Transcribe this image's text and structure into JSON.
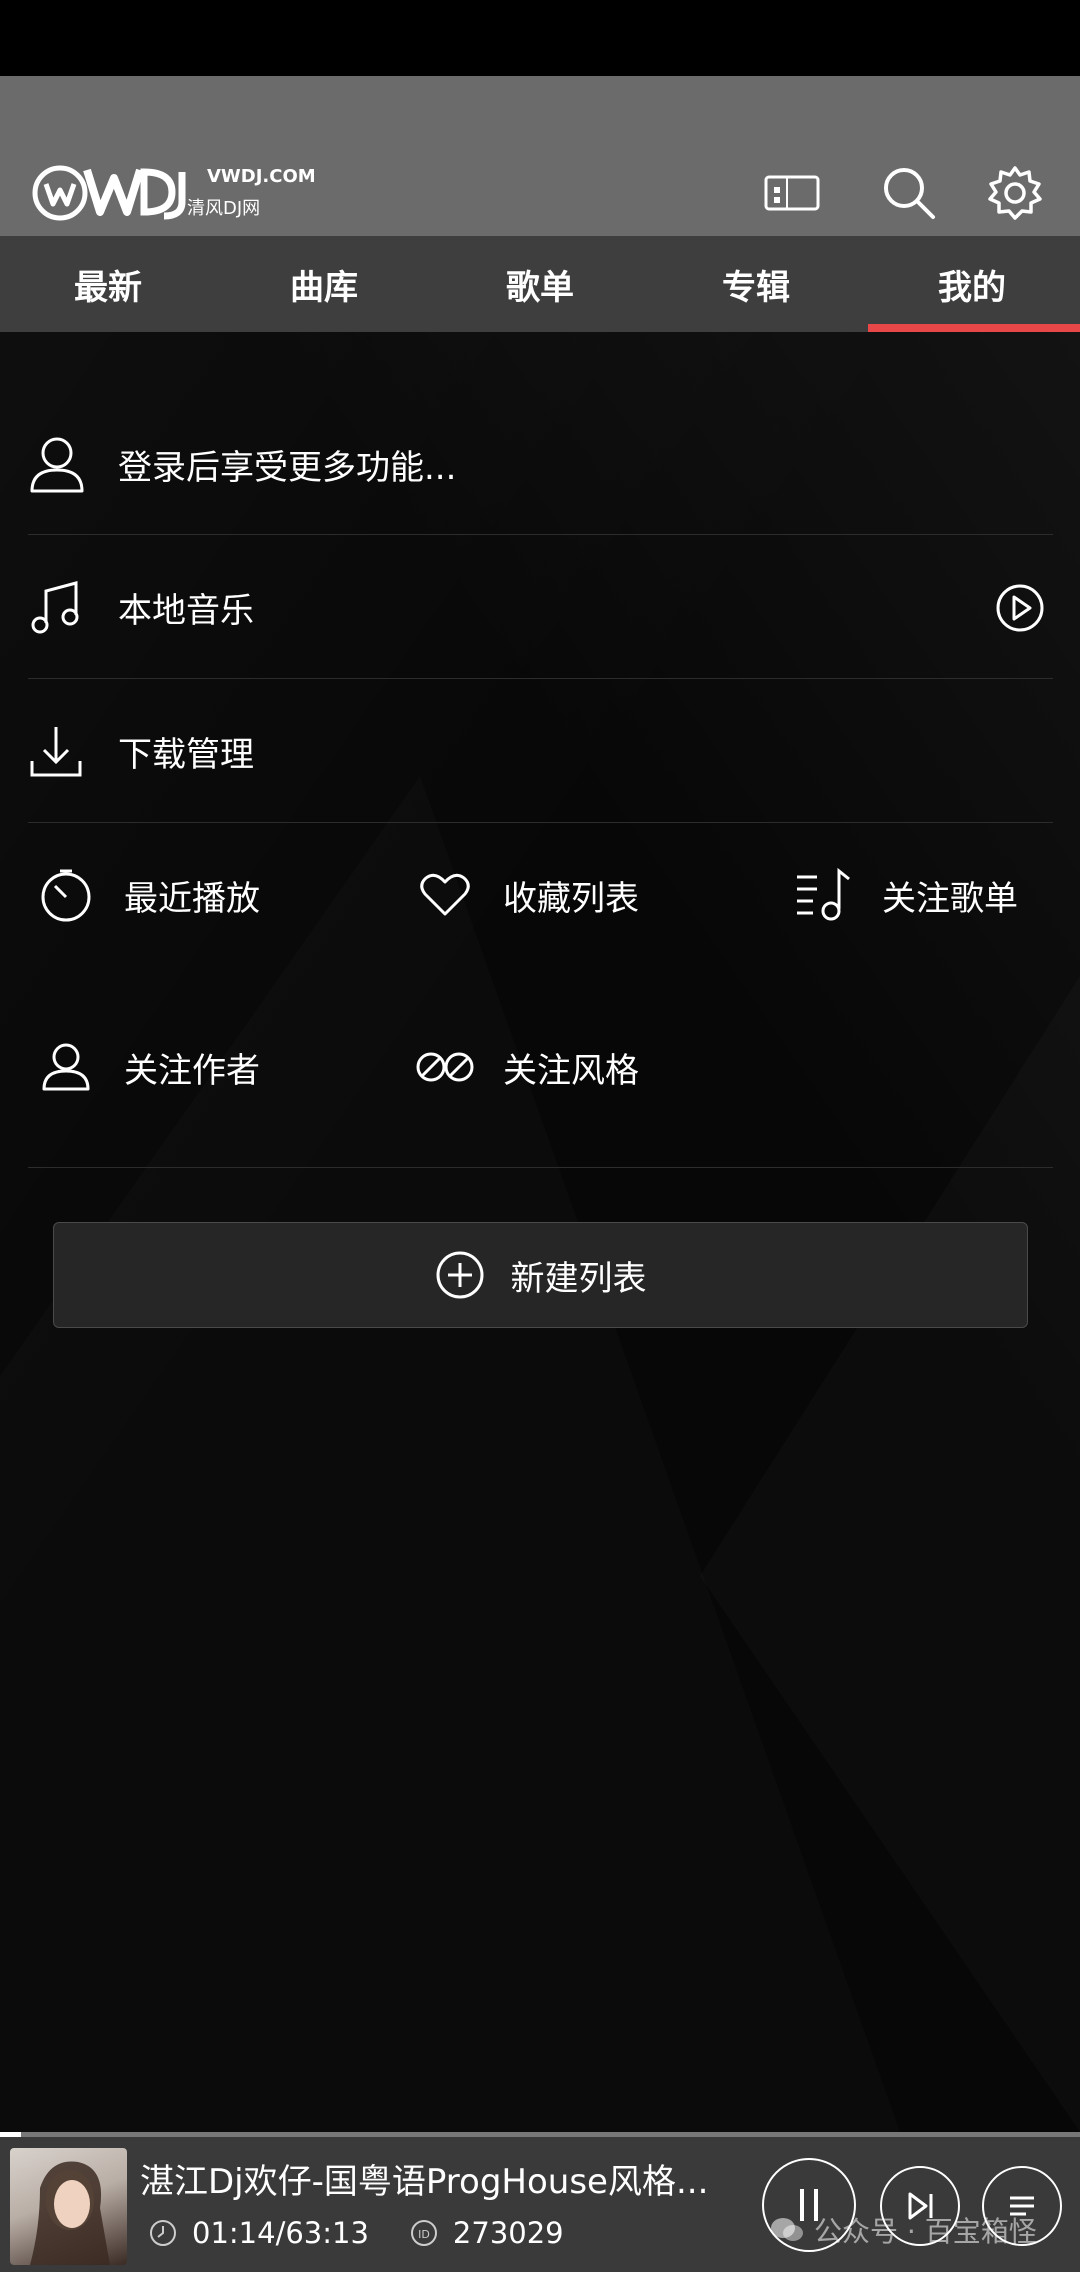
{
  "header": {
    "logo_text": "VWDJ.COM",
    "logo_sub": "清风DJ网"
  },
  "tabs": [
    {
      "label": "最新"
    },
    {
      "label": "曲库"
    },
    {
      "label": "歌单"
    },
    {
      "label": "专辑"
    },
    {
      "label": "我的",
      "active": true
    }
  ],
  "mine": {
    "login_prompt": "登录后享受更多功能...",
    "local_music": "本地音乐",
    "downloads": "下载管理",
    "recent": "最近播放",
    "favorites": "收藏列表",
    "followed_playlists": "关注歌单",
    "followed_authors": "关注作者",
    "followed_styles": "关注风格",
    "new_list_label": "新建列表"
  },
  "player": {
    "title": "湛江Dj欢仔-国粤语ProgHouse风格...",
    "time": "01:14/63:13",
    "id": "273029",
    "progress": 0.0195
  },
  "watermark": {
    "text": "公众号 · 百宝箱怪"
  },
  "colors": {
    "accent": "#e8474a",
    "header_bg": "#6b6b6b",
    "tabs_bg": "#3e3e3e",
    "page_bg": "#050505",
    "player_bg": "#3a3a3a"
  },
  "icons": {
    "cast": "cast-icon",
    "search": "search-icon",
    "settings": "gear-icon",
    "user": "user-icon",
    "music": "music-note-icon",
    "play": "play-circle-icon",
    "download": "download-icon",
    "recent": "timer-icon",
    "favorite": "heart-icon",
    "playlist": "playlist-music-icon",
    "author": "author-icon",
    "style": "style-icon",
    "add": "plus-circle-icon"
  }
}
